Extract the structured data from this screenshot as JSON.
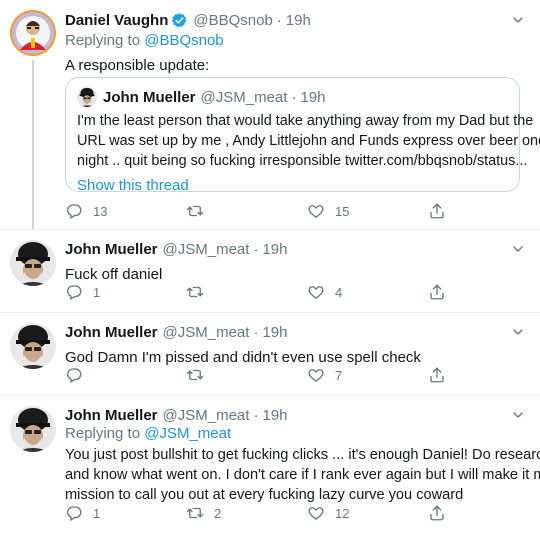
{
  "tweets": [
    {
      "name": "Daniel Vaughn",
      "handle": "@BBQsnob",
      "time": "19h",
      "replying_prefix": "Replying to ",
      "replying_to": "@BBQsnob",
      "text": "A responsible update:",
      "verified": true,
      "quote": {
        "name": "John Mueller",
        "handle": "@JSM_meat",
        "time": "19h",
        "text_line1": "I'm the least person that would take anything away from my Dad but the",
        "text_line2": "URL was set up by me , Andy Littlejohn and Funds  express over beer one",
        "text_line3": "night .. quit being so fucking irresponsible twitter.com/bbqsnob/status...",
        "show_thread": "Show this thread"
      },
      "counts": {
        "reply": "13",
        "retweet": "",
        "like": "15"
      }
    },
    {
      "name": "John Mueller",
      "handle": "@JSM_meat",
      "time": "19h",
      "text": "Fuck off daniel",
      "counts": {
        "reply": "1",
        "retweet": "",
        "like": "4"
      }
    },
    {
      "name": "John Mueller",
      "handle": "@JSM_meat",
      "time": "19h",
      "text": "God Damn I'm pissed and didn't even use spell check",
      "counts": {
        "reply": "",
        "retweet": "",
        "like": "7"
      }
    },
    {
      "name": "John Mueller",
      "handle": "@JSM_meat",
      "time": "19h",
      "replying_prefix": "Replying to ",
      "replying_to": "@JSM_meat",
      "text_line1": "You just post bullshit to get fucking clicks ... it's enough Daniel! Do research",
      "text_line2": "and know what went on. I don't care if I rank ever again but I will make it my",
      "text_line3": "mission to call you out at every fucking lazy curve you coward",
      "counts": {
        "reply": "1",
        "retweet": "2",
        "like": "12"
      }
    }
  ],
  "dot": "·",
  "colors": {
    "link": "#1b95e0",
    "muted": "#657786",
    "border": "#e6ecf0",
    "verified": "#1da1f2"
  },
  "icons": [
    "reply-icon",
    "retweet-icon",
    "like-icon",
    "share-icon",
    "chevron-down-icon",
    "verified-badge-icon"
  ]
}
